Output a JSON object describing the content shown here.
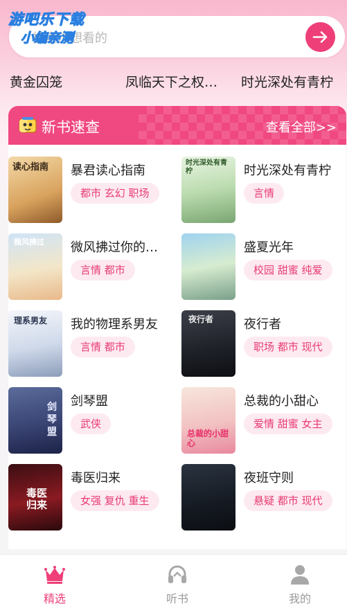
{
  "watermark": {
    "line1": "游吧乐下载",
    "line2": "小编亲测"
  },
  "search": {
    "placeholder": "搜索你想看的"
  },
  "hot_keywords": [
    "黄金囚笼",
    "凤临天下之权…",
    "时光深处有青柠"
  ],
  "section": {
    "title": "新书速查",
    "more": "查看全部>>"
  },
  "books": [
    {
      "title": "暴君读心指南",
      "tags": "都市 玄幻 职场",
      "cover_text": "读心指南"
    },
    {
      "title": "时光深处有青柠",
      "tags": "言情",
      "cover_text": "时光深处有青柠"
    },
    {
      "title": "微风拂过你的…",
      "tags": "言情 都市",
      "cover_text": "微风拂过"
    },
    {
      "title": "盛夏光年",
      "tags": "校园 甜蜜 纯爱",
      "cover_text": ""
    },
    {
      "title": "我的物理系男友",
      "tags": "言情 都市",
      "cover_text": "理系男友"
    },
    {
      "title": "夜行者",
      "tags": "职场 都市 现代",
      "cover_text": "夜行者"
    },
    {
      "title": "剑琴盟",
      "tags": "武侠",
      "cover_text": "剑琴盟"
    },
    {
      "title": "总裁的小甜心",
      "tags": "爱情 甜蜜 女主",
      "cover_text": "总裁的小甜心"
    },
    {
      "title": "毒医归来",
      "tags": "女强 复仇 重生",
      "cover_text": "毒医归来"
    },
    {
      "title": "夜班守则",
      "tags": "悬疑 都市 现代",
      "cover_text": ""
    }
  ],
  "tabs": [
    {
      "label": "精选",
      "icon": "crown-icon",
      "active": true
    },
    {
      "label": "听书",
      "icon": "headset-icon",
      "active": false
    },
    {
      "label": "我的",
      "icon": "user-icon",
      "active": false
    }
  ],
  "colors": {
    "accent": "#ee3f78",
    "tag_bg": "#fdeaf0",
    "tag_text": "#e83c74",
    "inactive": "#9a9a9a"
  }
}
